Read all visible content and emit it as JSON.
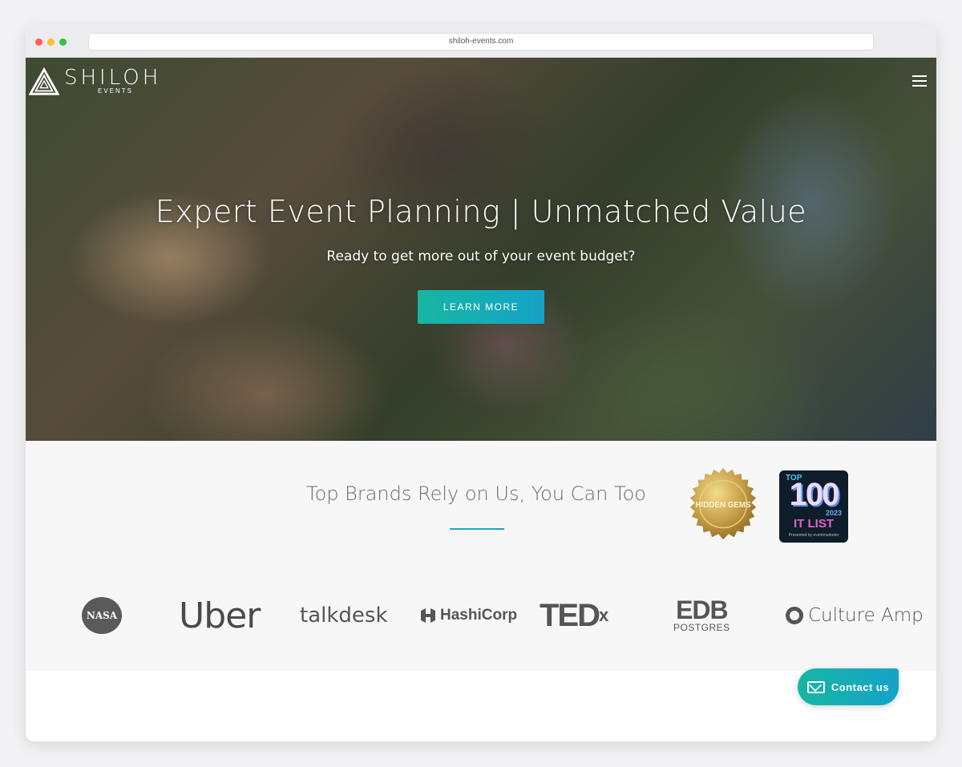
{
  "browser": {
    "url": "shiloh-events.com"
  },
  "header": {
    "logo_name": "SHILOH",
    "logo_sub": "EVENTS"
  },
  "hero": {
    "title": "Expert Event Planning | Unmatched Value",
    "subtitle": "Ready to get more out of your event budget?",
    "cta_label": "LEARN MORE"
  },
  "brands": {
    "heading": "Top Brands Rely on Us, You Can Too",
    "badges": {
      "gold_badge_text": "HIDDEN GEMS",
      "top100_top": "TOP",
      "top100_number": "100",
      "top100_year": "2023",
      "top100_list": "IT LIST",
      "top100_by": "Presented by eventmarketer"
    },
    "logos": {
      "nasa": "NASA",
      "uber": "Uber",
      "talkdesk": "talkdesk",
      "hashicorp": "HashiCorp",
      "tedx_main": "TED",
      "tedx_sup": "x",
      "edb_main": "EDB",
      "edb_sub": "POSTGRES",
      "cultureamp": "Culture Amp"
    }
  },
  "contact": {
    "label": "Contact us"
  },
  "colors": {
    "accent_start": "#17b6a2",
    "accent_end": "#15a3c9",
    "rule": "#1aa6c0"
  }
}
